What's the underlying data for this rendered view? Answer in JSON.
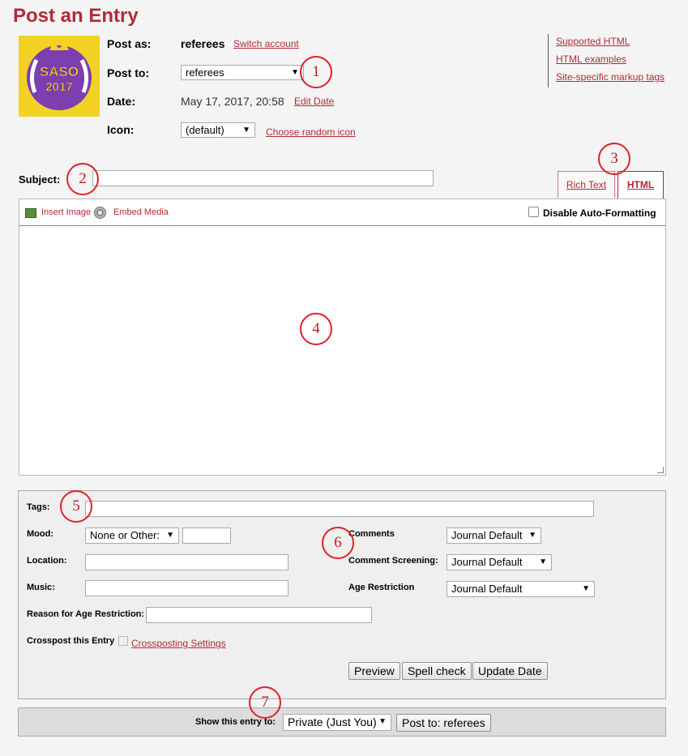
{
  "page": {
    "title": "Post an Entry"
  },
  "header": {
    "post_as_label": "Post as:",
    "post_as_value": "referees",
    "switch_account": "Switch account",
    "post_to_label": "Post to:",
    "post_to_value": "referees",
    "date_label": "Date:",
    "date_value": "May 17, 2017, 20:58",
    "edit_date": "Edit Date",
    "icon_label": "Icon:",
    "icon_value": "(default)",
    "random_icon": "Choose random icon",
    "avatar_text_top": "SASO",
    "avatar_text_bottom": "2017"
  },
  "help_links": [
    "Supported HTML",
    "HTML examples",
    "Site-specific markup tags"
  ],
  "subject": {
    "label": "Subject:",
    "value": ""
  },
  "editor_tabs": {
    "rich_text": "Rich Text",
    "html": "HTML"
  },
  "toolbar": {
    "insert_image": "Insert Image",
    "embed_media": "Embed Media",
    "disable_autoformat": "Disable Auto-Formatting"
  },
  "options": {
    "tags_label": "Tags:",
    "mood_label": "Mood:",
    "mood_value": "None or Other:",
    "location_label": "Location:",
    "music_label": "Music:",
    "age_reason_label": "Reason for Age Restriction:",
    "crosspost_label": "Crosspost this Entry",
    "crosspost_settings": "Crossposting Settings",
    "comments_label": "Comments",
    "comments_value": "Journal Default",
    "screening_label": "Comment Screening:",
    "screening_value": "Journal Default",
    "age_label": "Age Restriction",
    "age_value": "Journal Default"
  },
  "actions": {
    "preview": "Preview",
    "spell_check": "Spell check",
    "update_date": "Update Date"
  },
  "footer": {
    "show_label": "Show this entry to:",
    "visibility_value": "Private (Just You)",
    "post_button": "Post to: referees"
  },
  "markers": [
    "1",
    "2",
    "3",
    "4",
    "5",
    "6",
    "7"
  ],
  "colors": {
    "accent": "#b32a35",
    "marker": "#e0202a",
    "avatar_bg": "#7a3fb2",
    "avatar_gold": "#f2c81f"
  }
}
